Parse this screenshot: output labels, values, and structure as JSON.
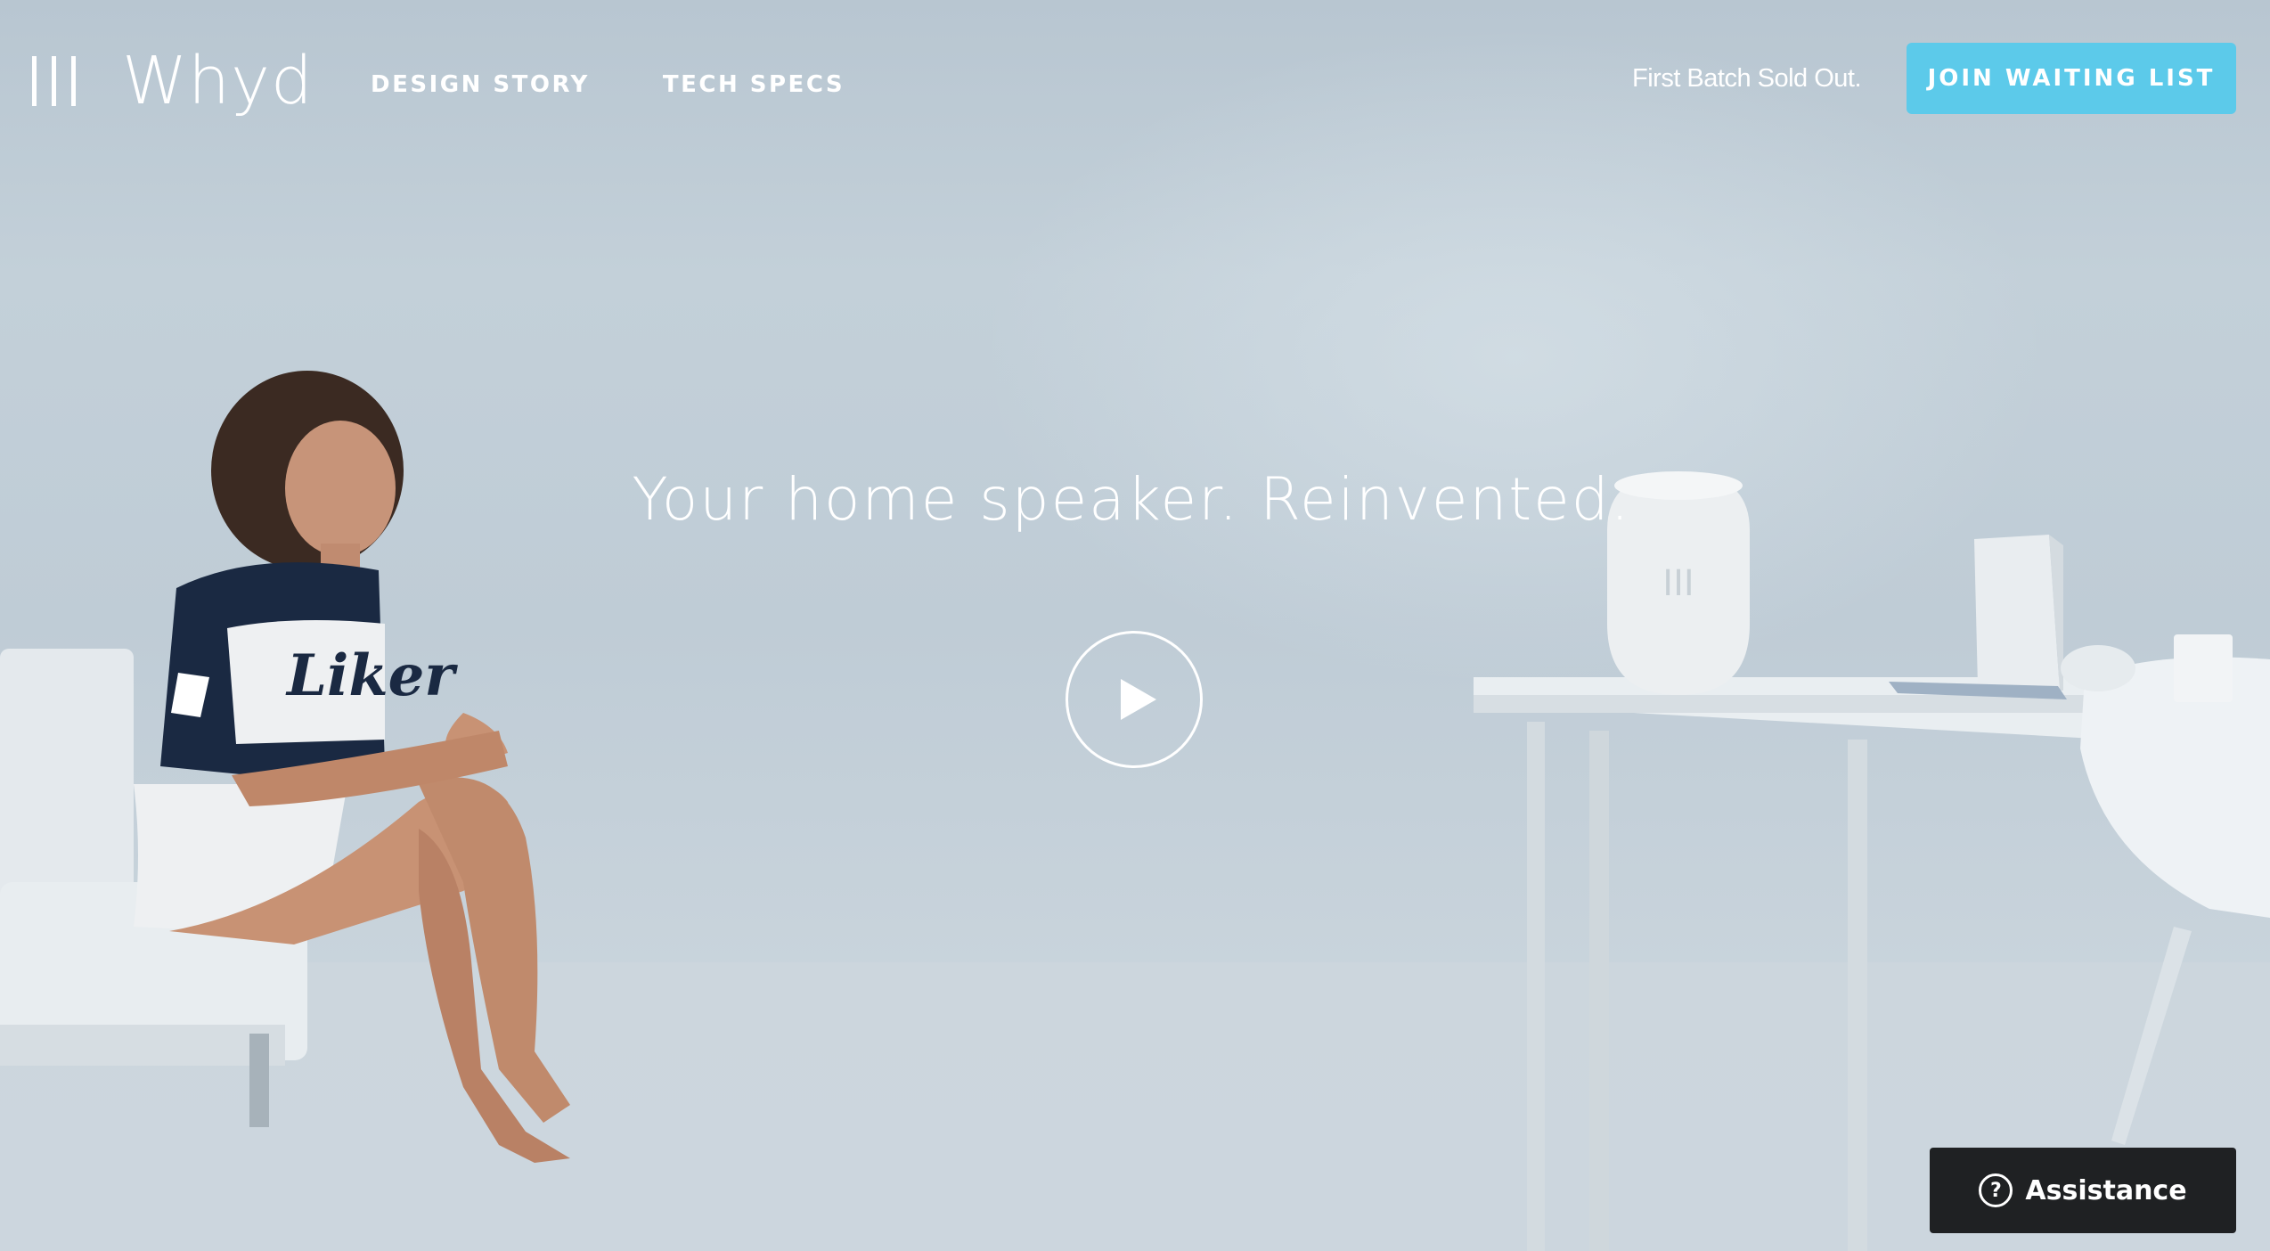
{
  "brand": {
    "logo_icon": "three-bars-logo-icon",
    "name": "Whyd"
  },
  "nav": {
    "items": [
      {
        "label": "DESIGN STORY"
      },
      {
        "label": "TECH SPECS"
      }
    ]
  },
  "header": {
    "status_text": "First Batch Sold Out.",
    "cta_label": "JOIN WAITING LIST"
  },
  "hero": {
    "headline": "Your home speaker. Reinvented.",
    "play_icon": "play-icon",
    "shirt_text": "Liker",
    "speaker_mark": "III"
  },
  "assistance": {
    "icon": "question-circle-icon",
    "icon_glyph": "?",
    "label": "Assistance"
  },
  "colors": {
    "accent": "#5ccaea",
    "background": "#c0cdd7",
    "assist_bg": "#1f2123",
    "text": "#ffffff"
  }
}
